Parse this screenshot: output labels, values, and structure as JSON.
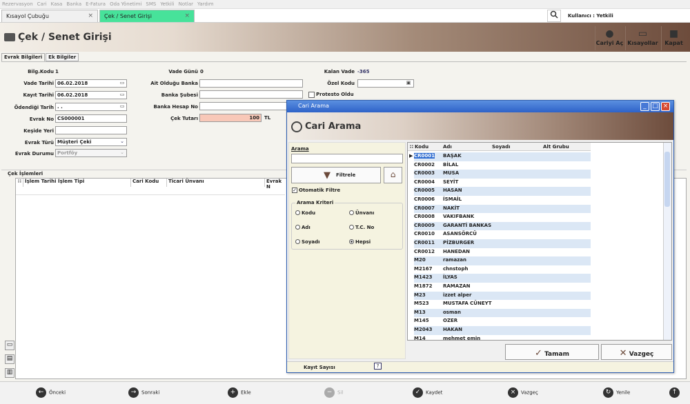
{
  "menu": [
    "Rezervasyon",
    "Cari",
    "Kasa",
    "Banka",
    "E-Fatura",
    "Oda Yönetimi",
    "SMS",
    "Yetkili",
    "Notlar",
    "Yardım"
  ],
  "tabs": [
    {
      "label": "Kısayol Çubuğu",
      "close": "×"
    },
    {
      "label": "Çek / Senet Girişi",
      "close": "×"
    }
  ],
  "user": "Kullanıcı : Yetkili",
  "page": {
    "title": "Çek / Senet Girişi",
    "buttons": [
      {
        "label": "Cariyi Aç",
        "icon": "user-icon"
      },
      {
        "label": "Kısayollar",
        "icon": "keyboard-icon"
      },
      {
        "label": "Kapat",
        "icon": "building-icon"
      }
    ]
  },
  "subtabs": [
    "Evrak Bilgileri",
    "Ek Bilgiler"
  ],
  "form": {
    "bilg_kodu_label": "Bilg.Kodu",
    "bilg_kodu": "1",
    "vade_tarihi_label": "Vade Tarihi",
    "vade_tarihi": "06.02.2018",
    "kayit_tarihi_label": "Kayıt Tarihi",
    "kayit_tarihi": "06.02.2018",
    "odendigi_tarih_label": "Ödendiği Tarih",
    "odendigi_tarih": ". .",
    "evrak_no_label": "Evrak No",
    "evrak_no": "CS000001",
    "keside_yeri_label": "Keşide Yeri",
    "keside_yeri": "",
    "evrak_turu_label": "Evrak Türü",
    "evrak_turu": "Müşteri Çeki",
    "evrak_durumu_label": "Evrak Durumu",
    "evrak_durumu": "Portföy",
    "vade_gunu_label": "Vade Günü",
    "vade_gunu": "0",
    "ait_banka_label": "Ait Olduğu Banka",
    "banka_subesi_label": "Banka Şubesi",
    "banka_hesap_label": "Banka Hesap No",
    "cek_tutari_label": "Çek Tutarı",
    "cek_tutari": "100",
    "currency": "TL",
    "kalan_vade_label": "Kalan Vade",
    "kalan_vade": "-365",
    "ozel_kodu_label": "Özel Kodu",
    "protesto_label": "Protesto Oldu"
  },
  "islemler": {
    "title": "Çek İşlemleri",
    "columns": [
      "İşlem Tarihi",
      "İşlem Tipi",
      "Cari Kodu",
      "Ticari Ünvanı",
      "Evrak N"
    ]
  },
  "footer": [
    "Önceki",
    "Sonraki",
    "Ekle",
    "Sil",
    "Kaydet",
    "Vazgeç",
    "Yenile"
  ],
  "dialog": {
    "window_title": "Cari Arama",
    "title": "Cari Arama",
    "arama_label": "Arama",
    "filtrele": "Filtrele",
    "otomatik": "Otomatik Filtre",
    "kriter_label": "Arama Kriteri",
    "radios": [
      "Kodu",
      "Ünvanı",
      "Adı",
      "T.C. No",
      "Soyadı",
      "Hepsi"
    ],
    "selected_radio": "Hepsi",
    "columns": [
      "Kodu",
      "Adı",
      "Soyadı",
      "Alt Grubu"
    ],
    "rows": [
      [
        "CR0001",
        "BAŞAK"
      ],
      [
        "CR0002",
        "BİLAL"
      ],
      [
        "CR0003",
        "MUSA"
      ],
      [
        "CR0004",
        "SEYİT"
      ],
      [
        "CR0005",
        "HASAN"
      ],
      [
        "CR0006",
        "İSMAİL"
      ],
      [
        "CR0007",
        "NAKİT"
      ],
      [
        "CR0008",
        "VAKIFBANK"
      ],
      [
        "CR0009",
        "GARANTİ BANKAS"
      ],
      [
        "CR0010",
        "ASANSÖRCÜ"
      ],
      [
        "CR0011",
        "PİZBURGER"
      ],
      [
        "CR0012",
        "HANEDAN"
      ],
      [
        "M20",
        "ramazan"
      ],
      [
        "M2167",
        "chnstoph"
      ],
      [
        "M1423",
        "İLYAS"
      ],
      [
        "M1872",
        "RAMAZAN"
      ],
      [
        "M23",
        "izzet alper"
      ],
      [
        "M523",
        "MUSTAFA CÜNEYT"
      ],
      [
        "M13",
        "osman"
      ],
      [
        "M145",
        "OZER"
      ],
      [
        "M2043",
        "HAKAN"
      ],
      [
        "M14",
        "mehmet emin"
      ]
    ],
    "tamam": "Tamam",
    "vazgec": "Vazgeç",
    "kayit_sayisi": "Kayıt Sayısı",
    "help": "?"
  }
}
